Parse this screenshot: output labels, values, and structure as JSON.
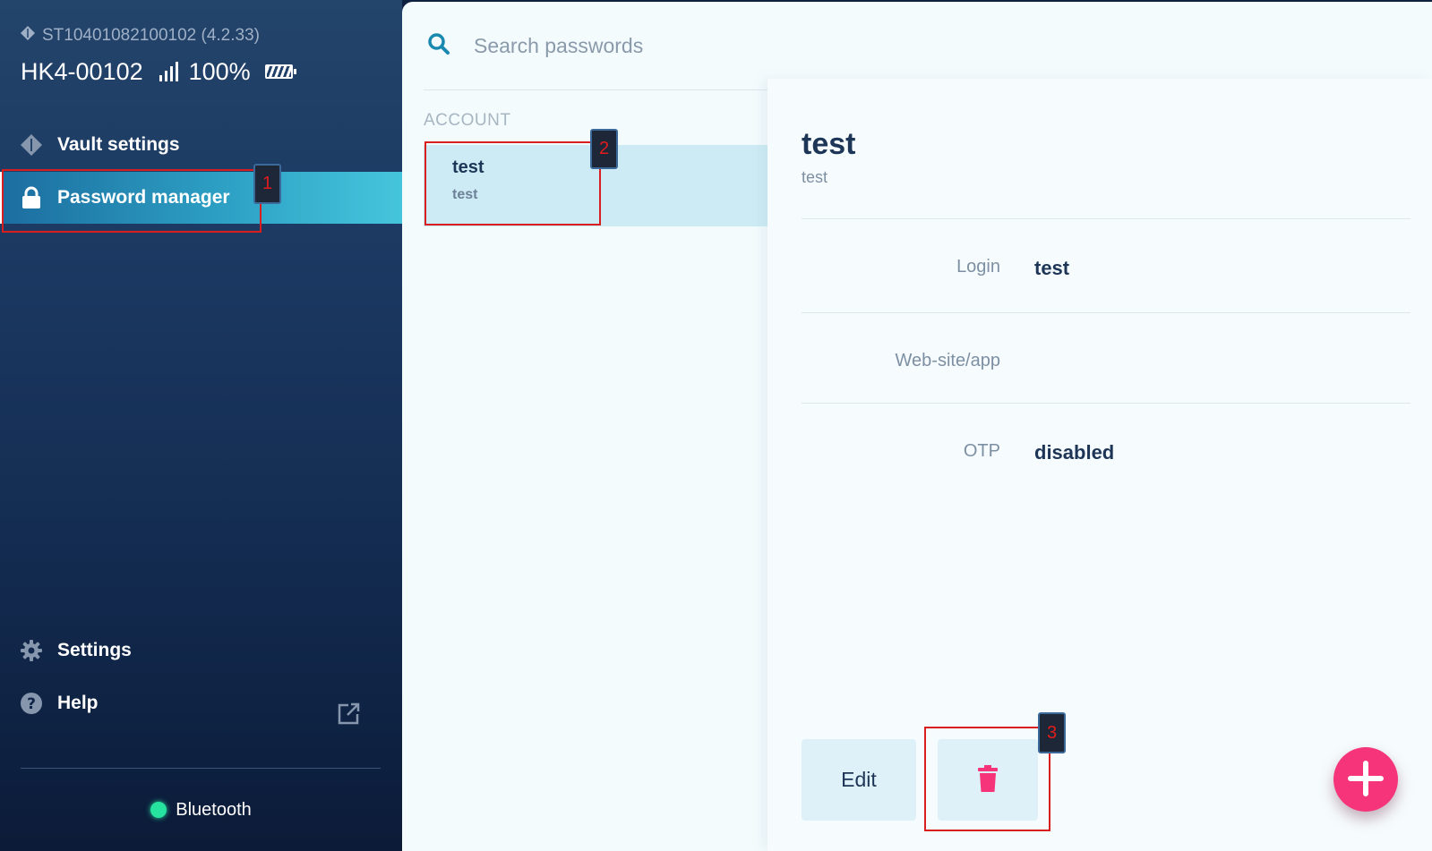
{
  "sidebar": {
    "device_id": "ST10401082100102 (4.2.33)",
    "device_name": "HK4-00102",
    "battery_percent": "100%",
    "battery_level": 1.0,
    "nav": {
      "vault_settings": "Vault settings",
      "password_manager": "Password manager",
      "settings": "Settings",
      "help": "Help"
    },
    "active_item": "password_manager",
    "connection": {
      "label": "Bluetooth",
      "status_color": "#27e3a0"
    }
  },
  "search": {
    "placeholder": "Search passwords",
    "value": ""
  },
  "list": {
    "section_label": "ACCOUNT",
    "items": [
      {
        "title": "test",
        "subtitle": "test",
        "selected": true
      }
    ]
  },
  "detail": {
    "title": "test",
    "subtitle": "test",
    "fields": [
      {
        "label": "Login",
        "value": "test"
      },
      {
        "label": "Web-site/app",
        "value": ""
      },
      {
        "label": "OTP",
        "value": "disabled"
      }
    ],
    "edit_label": "Edit"
  },
  "markers": {
    "m1": "1",
    "m2": "2",
    "m3": "3",
    "color": "#d81e1e"
  },
  "colors": {
    "accent": "#2da0c4",
    "delete": "#f5347a",
    "fab": "#f5347a"
  },
  "icons": [
    "diamond-icon",
    "signal-icon",
    "battery-icon",
    "lock-icon",
    "gear-icon",
    "help-circle-icon",
    "external-link-icon",
    "search-icon",
    "trash-icon",
    "plus-icon"
  ]
}
